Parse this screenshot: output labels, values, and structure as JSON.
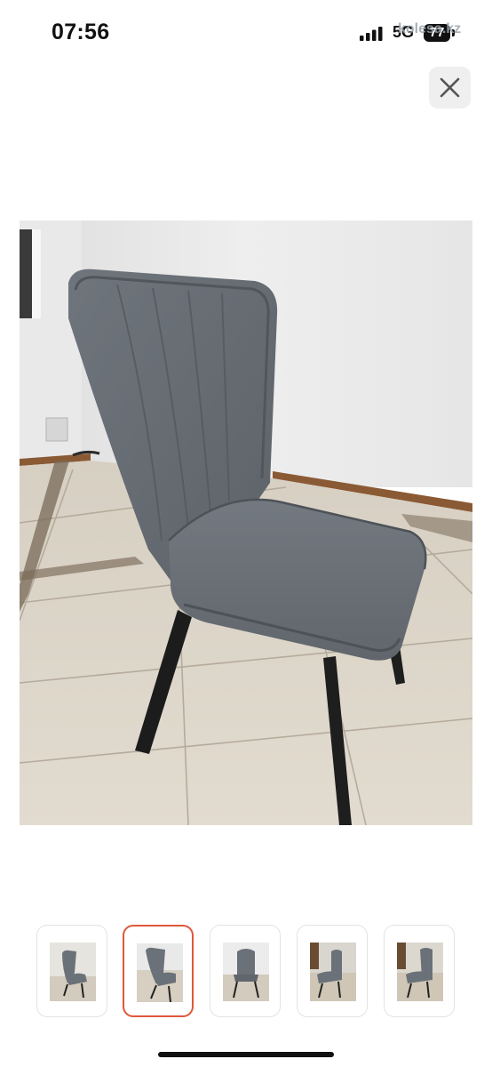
{
  "status_bar": {
    "time": "07:56",
    "network": "5G",
    "battery": "77",
    "watermark": "kolesa.kz"
  },
  "viewer": {
    "close_icon": "close-icon",
    "main_image": "grey-upholstered-chair-photo",
    "selected_index": 2,
    "thumbnails": [
      {
        "image": "chair-thumbnail-1"
      },
      {
        "image": "chair-thumbnail-2"
      },
      {
        "image": "chair-thumbnail-3"
      },
      {
        "image": "chair-thumbnail-4"
      },
      {
        "image": "chair-thumbnail-5"
      }
    ]
  },
  "colors": {
    "selected_border": "#e0573a",
    "upholstery": "#6b7178",
    "floor": "#d9d2c6",
    "wall": "#ededed"
  }
}
